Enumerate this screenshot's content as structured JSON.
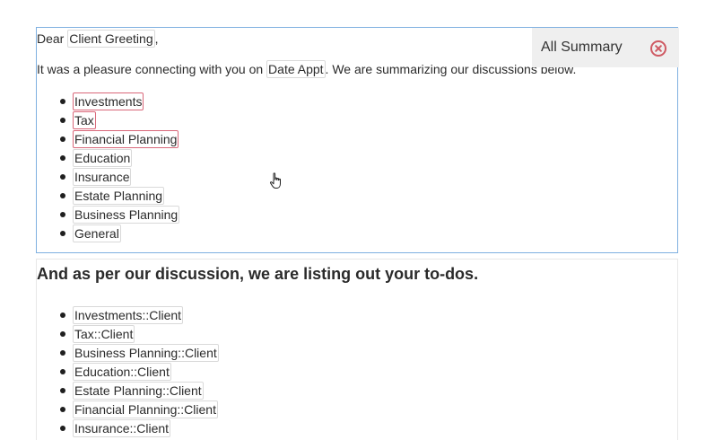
{
  "greeting": {
    "prefix": "Dear ",
    "token": "Client Greeting",
    "suffix": ","
  },
  "intro": {
    "prefix": "It was a pleasure connecting with you on ",
    "token": "Date Appt",
    "suffix": ". We are summarizing our discussions below."
  },
  "summary_panel": {
    "label": "All Summary",
    "close_icon": "close-circle-icon"
  },
  "topics": [
    {
      "label": "Investments",
      "highlighted": true
    },
    {
      "label": "Tax",
      "highlighted": true
    },
    {
      "label": "Financial Planning",
      "highlighted": true
    },
    {
      "label": "Education",
      "highlighted": false
    },
    {
      "label": "Insurance",
      "highlighted": false
    },
    {
      "label": "Estate Planning",
      "highlighted": false
    },
    {
      "label": "Business Planning",
      "highlighted": false
    },
    {
      "label": "General",
      "highlighted": false
    }
  ],
  "todos": {
    "heading": "And as per our discussion, we are listing out your to-dos.",
    "items": [
      "Investments::Client",
      "Tax::Client",
      "Business Planning::Client",
      "Education::Client",
      "Estate Planning::Client",
      "Financial Planning::Client",
      "Insurance::Client"
    ]
  },
  "colors": {
    "selected_border": "#7fb0e0",
    "highlight_token_border": "#d9687a",
    "close_icon": "#cf5a63",
    "panel_background": "#efefef"
  },
  "cursor_icon": "hand-pointer-icon"
}
